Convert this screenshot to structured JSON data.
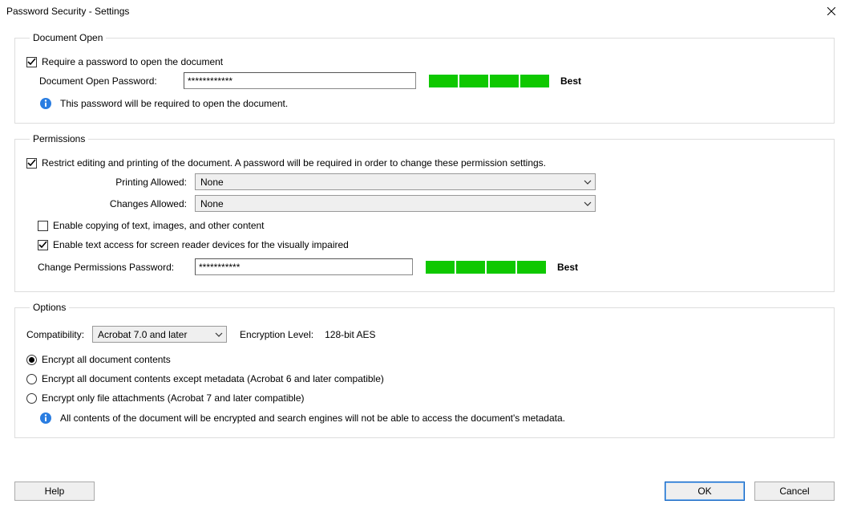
{
  "window": {
    "title": "Password Security - Settings"
  },
  "doc_open": {
    "legend": "Document Open",
    "require_label": "Require a password to open the document",
    "password_label": "Document Open Password:",
    "password_value": "************",
    "strength_label": "Best",
    "info_text": "This password will be required to open the document."
  },
  "permissions": {
    "legend": "Permissions",
    "restrict_label": "Restrict editing and printing of the document. A password will be required in order to change these permission settings.",
    "printing_label": "Printing Allowed:",
    "printing_value": "None",
    "changes_label": "Changes Allowed:",
    "changes_value": "None",
    "enable_copy_label": "Enable copying of text, images, and other content",
    "enable_screenreader_label": "Enable text access for screen reader devices for the visually impaired",
    "change_pw_label": "Change Permissions Password:",
    "change_pw_value": "***********",
    "strength_label": "Best"
  },
  "options": {
    "legend": "Options",
    "compat_label": "Compatibility:",
    "compat_value": "Acrobat 7.0 and later",
    "enc_level_label": "Encryption Level:",
    "enc_level_value": "128-bit AES",
    "r1_label": "Encrypt all document contents",
    "r2_label": "Encrypt all document contents except metadata (Acrobat 6 and later compatible)",
    "r3_label": "Encrypt only file attachments (Acrobat 7 and later compatible)",
    "info_text": "All contents of the document will be encrypted and search engines will not be able to access the document's metadata."
  },
  "footer": {
    "help": "Help",
    "ok": "OK",
    "cancel": "Cancel"
  }
}
